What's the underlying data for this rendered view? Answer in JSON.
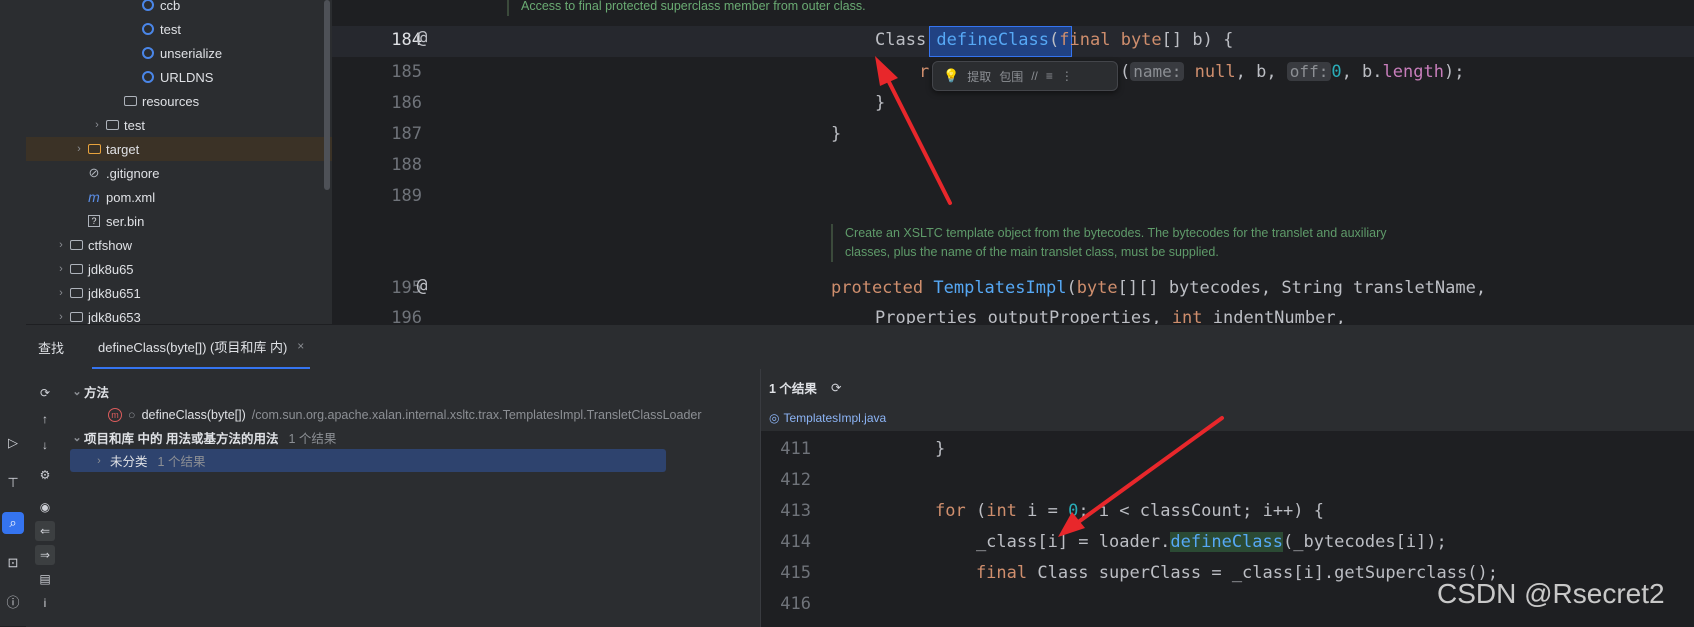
{
  "tree": {
    "items": [
      {
        "label": "ccb",
        "indent": 4,
        "icon": "class-icon",
        "chev": ""
      },
      {
        "label": "test",
        "indent": 4,
        "icon": "class-icon",
        "chev": ""
      },
      {
        "label": "unserialize",
        "indent": 4,
        "icon": "class-icon",
        "chev": ""
      },
      {
        "label": "URLDNS",
        "indent": 4,
        "icon": "class-icon",
        "chev": ""
      },
      {
        "label": "resources",
        "indent": 3,
        "icon": "folder-icon",
        "chev": ""
      },
      {
        "label": "test",
        "indent": 2,
        "icon": "folder-icon",
        "chev": "›"
      },
      {
        "label": "target",
        "indent": 1,
        "icon": "folder-icon-orange",
        "chev": "›"
      },
      {
        "label": ".gitignore",
        "indent": 1,
        "icon": "ignore-icon",
        "chev": ""
      },
      {
        "label": "pom.xml",
        "indent": 1,
        "icon": "maven-icon",
        "chev": ""
      },
      {
        "label": "ser.bin",
        "indent": 1,
        "icon": "unknown-file-icon",
        "chev": ""
      },
      {
        "label": "ctfshow",
        "indent": 0,
        "icon": "folder-icon",
        "chev": "›"
      },
      {
        "label": "jdk8u65",
        "indent": 0,
        "icon": "folder-icon",
        "chev": "›"
      },
      {
        "label": "jdk8u651",
        "indent": 0,
        "icon": "folder-icon",
        "chev": "›"
      },
      {
        "label": "jdk8u653",
        "indent": 0,
        "icon": "folder-icon",
        "chev": "›"
      }
    ]
  },
  "editor": {
    "doc_top": "Access to final protected superclass member from outer class.",
    "line_184": "184",
    "line_185": "185",
    "line_186": "186",
    "line_187": "187",
    "line_188": "188",
    "line_189": "189",
    "line_195": "195",
    "line_196": "196",
    "code_184_a": "Class ",
    "code_184_fn": "defineClass",
    "code_184_b": "(",
    "code_184_kw": "final",
    "code_184_c": " ",
    "code_184_kw2": "byte",
    "code_184_d": "[] b) {",
    "code_185_a": "r",
    "code_185_paren": "(",
    "hint_name": "name:",
    "code_185_null": " null",
    "code_185_b": ", b, ",
    "hint_off": "off:",
    "code_185_zero": "0",
    "code_185_c": ", b.",
    "code_185_field": "length",
    "code_185_d": ");",
    "code_186": "}",
    "code_187": "}",
    "doc_mid_1": "Create an XSLTC template object from the bytecodes. The bytecodes for the translet and auxiliary",
    "doc_mid_2": "classes, plus the name of the main translet class, must be supplied.",
    "code_195_kw": "protected",
    "code_195_fn": "TemplatesImpl",
    "code_195_a": "(",
    "code_195_kw2": "byte",
    "code_195_b": "[][] bytecodes, String transletName,",
    "code_196_a": "Properties outputProperties, ",
    "code_196_kw": "int",
    "code_196_b": " indentNumber,",
    "toolbar": {
      "extract": "提取",
      "wrap": "包围",
      "comment": "//",
      "format": "≡",
      "more": "⋮"
    }
  },
  "bottom": {
    "find_label": "查找",
    "tab_label": "defineClass(byte[]) (项目和库 内)",
    "tab_close": "×",
    "methods_header": "方法",
    "method_item": "defineClass(byte[])",
    "method_path": "/com.sun.org.apache.xalan.internal.xsltc.trax.TemplatesImpl.TransletClassLoader",
    "usages_header": "项目和库 中的 用法或基方法的用法",
    "usages_count": "1 个结果",
    "uncat_label": "未分类",
    "uncat_count": "1 个结果",
    "preview_count": "1 个结果",
    "preview_file": "TemplatesImpl.java",
    "p411": "411",
    "p412": "412",
    "p413": "413",
    "p414": "414",
    "p415": "415",
    "p416": "416",
    "pc411": "}",
    "pc413_kw": "for",
    "pc413_a": " (",
    "pc413_kw2": "int",
    "pc413_b": " i = ",
    "pc413_num": "0",
    "pc413_c": "; i < classCount; i++) {",
    "pc414_a": "    _class[i] = loader.",
    "pc414_match": "defineClass",
    "pc414_b": "(_bytecodes[i]);",
    "pc415_kw": "    final",
    "pc415_a": " Class superClass = _class[i].getSuperclass();"
  },
  "watermark": "CSDN @Rsecret2",
  "colors": {
    "accent": "#3574f0",
    "arrow": "#e8272b",
    "keyword": "#cf8e6d",
    "function": "#56a8f5"
  }
}
